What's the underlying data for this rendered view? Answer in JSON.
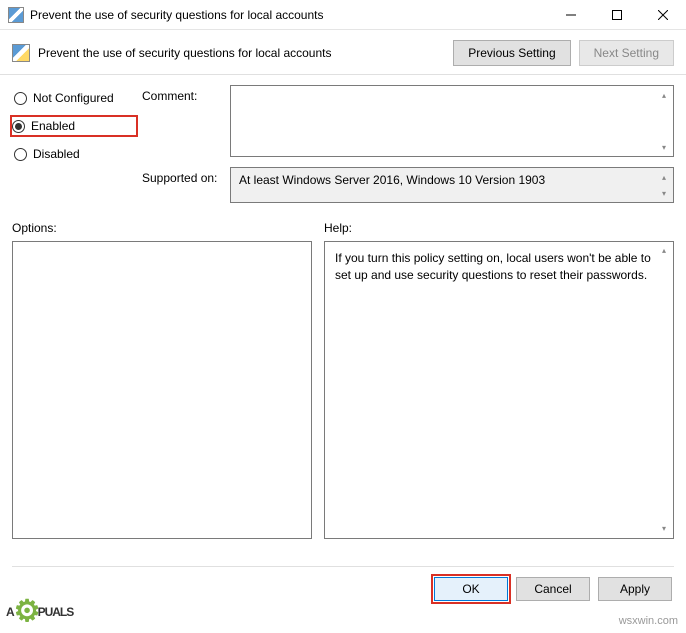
{
  "titlebar": {
    "title": "Prevent the use of security questions for local accounts"
  },
  "header": {
    "title": "Prevent the use of security questions for local accounts",
    "prev_label": "Previous Setting",
    "next_label": "Next Setting"
  },
  "radios": {
    "not_configured": "Not Configured",
    "enabled": "Enabled",
    "disabled": "Disabled"
  },
  "fields": {
    "comment_label": "Comment:",
    "supported_label": "Supported on:",
    "supported_value": "At least Windows Server 2016, Windows 10 Version 1903"
  },
  "sections": {
    "options_label": "Options:",
    "help_label": "Help:",
    "help_text": "If you turn this policy setting on, local users won't be able to set up and use security questions to reset their passwords."
  },
  "footer": {
    "ok": "OK",
    "cancel": "Cancel",
    "apply": "Apply"
  },
  "watermarks": {
    "left_prefix": "A",
    "left_suffix": "PUALS",
    "right": "wsxwin.com"
  }
}
